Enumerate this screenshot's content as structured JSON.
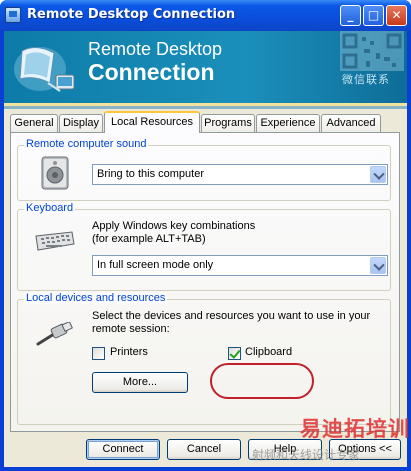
{
  "window": {
    "title": "Remote Desktop Connection",
    "controls": {
      "minimize": "_",
      "maximize": "□",
      "close": "✕"
    }
  },
  "banner": {
    "line1": "Remote Desktop",
    "line2": "Connection",
    "watermark_text": "微信联系"
  },
  "tabs": [
    {
      "label": "General"
    },
    {
      "label": "Display"
    },
    {
      "label": "Local Resources",
      "active": true
    },
    {
      "label": "Programs"
    },
    {
      "label": "Experience"
    },
    {
      "label": "Advanced"
    }
  ],
  "remote_sound": {
    "title": "Remote computer sound",
    "selected": "Bring to this computer",
    "icon": "speaker-icon"
  },
  "keyboard": {
    "title": "Keyboard",
    "description_line1": "Apply Windows key combinations",
    "description_line2": "(for example ALT+TAB)",
    "selected": "In full screen mode only",
    "icon": "keyboard-icon"
  },
  "local_devices": {
    "title": "Local devices and resources",
    "description_line1": "Select the devices and resources you want to use in your",
    "description_line2": "remote session:",
    "printers_label": "Printers",
    "printers_checked": false,
    "clipboard_label": "Clipboard",
    "clipboard_checked": true,
    "more_label": "More...",
    "icon": "usb-plug-icon"
  },
  "footer": {
    "connect": "Connect",
    "cancel": "Cancel",
    "help": "Help",
    "options": "Options <<"
  },
  "watermark": {
    "brand": "易迪拓培训",
    "tagline": "射频和天线设计专家"
  },
  "colors": {
    "title_bar": "#0a4fdc",
    "banner": "#1b8fbb",
    "group_title": "#0046d5",
    "highlight": "#c0212a"
  }
}
